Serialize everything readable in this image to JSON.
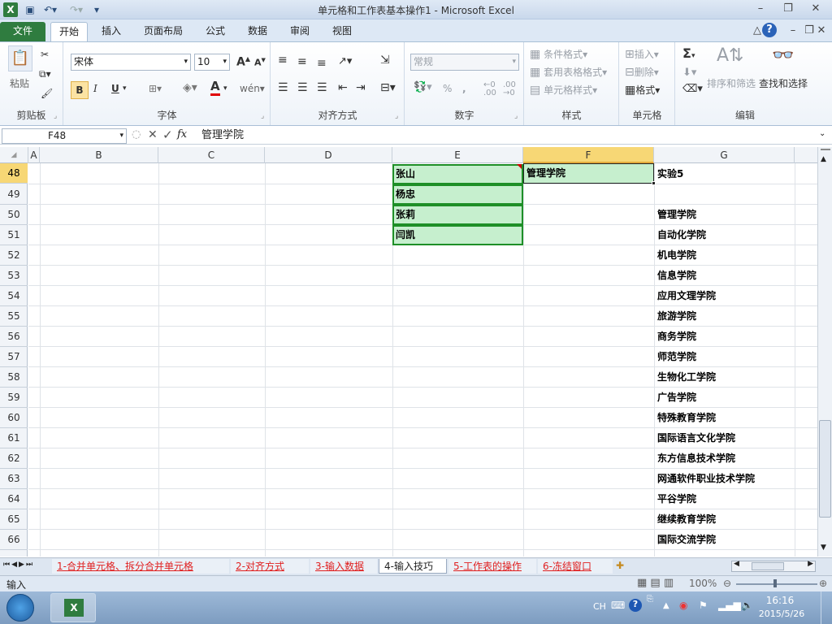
{
  "window": {
    "title": "单元格和工作表基本操作1  -  Microsoft Excel",
    "controls": [
      "–",
      "❐",
      "✕"
    ]
  },
  "ribbon_tabs": [
    "文件",
    "开始",
    "插入",
    "页面布局",
    "公式",
    "数据",
    "审阅",
    "视图"
  ],
  "groups": {
    "clipboard": {
      "label": "剪贴板",
      "paste": "粘贴"
    },
    "font": {
      "label": "字体",
      "name": "宋体",
      "size": "10",
      "bold": "B",
      "italic": "I",
      "underline": "U",
      "grow": "A",
      "shrink": "A",
      "color_letter": "A"
    },
    "alignment": {
      "label": "对齐方式"
    },
    "number": {
      "label": "数字",
      "format": "常规",
      "percent": "%"
    },
    "styles": {
      "label": "样式",
      "conditional": "条件格式",
      "table": "套用表格格式",
      "cell_styles": "单元格样式"
    },
    "cells": {
      "label": "单元格",
      "insert": "插入",
      "delete": "删除",
      "format": "格式"
    },
    "editing": {
      "label": "编辑",
      "sum": "Σ",
      "sort": "排序和筛选",
      "find": "查找和选择"
    }
  },
  "formula_bar": {
    "name_box": "F48",
    "fx": "fx",
    "content": "管理学院"
  },
  "columns": [
    "A",
    "B",
    "C",
    "D",
    "E",
    "F",
    "G"
  ],
  "selected_column": "F",
  "rows": [
    "48",
    "49",
    "50",
    "51",
    "52",
    "53",
    "54",
    "55",
    "56",
    "57",
    "58",
    "59",
    "60",
    "61",
    "62",
    "63",
    "64",
    "65",
    "66"
  ],
  "selected_row": "48",
  "cells_E": [
    "张山",
    "杨忠",
    "张莉",
    "闫凯"
  ],
  "cell_F48": "管理学院",
  "column_G": [
    "实验5",
    "",
    "管理学院",
    "自动化学院",
    "机电学院",
    "信息学院",
    "应用文理学院",
    "旅游学院",
    "商务学院",
    "师范学院",
    "生物化工学院",
    "广告学院",
    "特殊教育学院",
    "国际语言文化学院",
    "东方信息技术学院",
    "网通软件职业技术学院",
    "平谷学院",
    "继续教育学院",
    "国际交流学院"
  ],
  "sheet_tabs": [
    "1-合并单元格、拆分合并单元格",
    "2-对齐方式",
    "3-输入数据",
    "4-输入技巧",
    "5-工作表的操作",
    "6-冻结窗口"
  ],
  "active_sheet": "4-输入技巧",
  "status": {
    "mode": "输入",
    "zoom": "100%"
  },
  "taskbar": {
    "lang": "CH",
    "time": "16:16",
    "date": "2015/5/26"
  },
  "colors": {
    "excel_green": "#2f7c3f",
    "cell_fill": "#c6efce",
    "selection_header": "#f7d775",
    "sheet_tab_text": "#e02020"
  }
}
